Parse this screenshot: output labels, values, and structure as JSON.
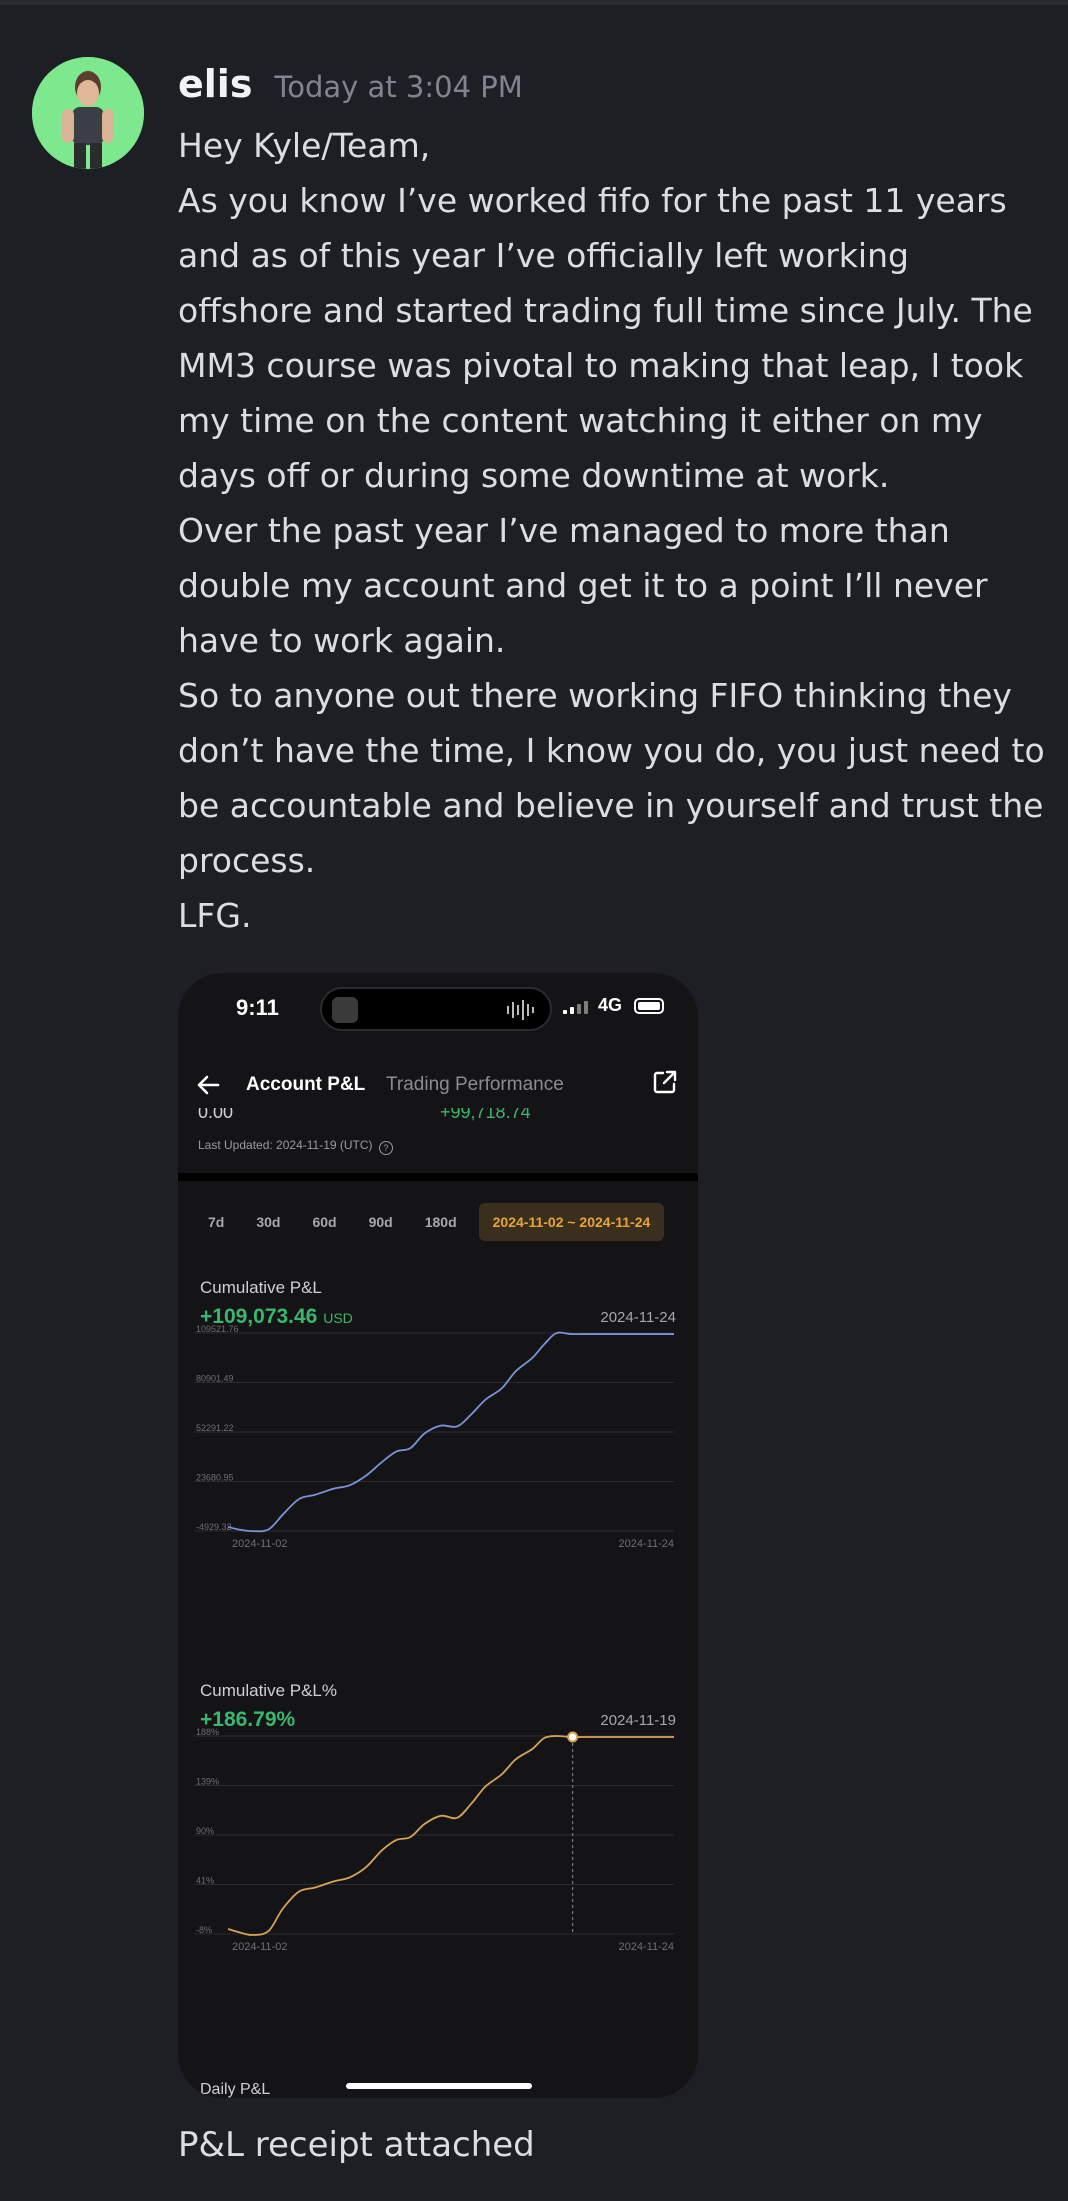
{
  "message": {
    "username": "elis",
    "timestamp": "Today at 3:04 PM",
    "lines": [
      "Hey Kyle/Team,",
      "As you know I’ve worked fifo for the past 11 years and as of this year I’ve officially left working offshore and started trading full time since July. The MM3 course was pivotal to making that leap, I took my time on the content watching it either on my days off or during some downtime at work.",
      "Over the past year I’ve managed to more than double my account and get it to a point I’ll never have to work again.",
      "So to anyone out there working FIFO thinking they don’t have the time, I know you do, you just need to be accountable and believe in yourself and trust the process.",
      "LFG."
    ],
    "footer": "P&L receipt attached"
  },
  "phone": {
    "status_time": "9:11",
    "network": "4G",
    "nav": {
      "active_tab": "Account P&L",
      "inactive_tab": "Trading Performance"
    },
    "cut_left": "0.00",
    "cut_right": "+99,718.74",
    "last_updated": "Last Updated: 2024-11-19 (UTC)",
    "ranges": [
      "7d",
      "30d",
      "60d",
      "90d",
      "180d"
    ],
    "selected_range": "2024-11-02 ~ 2024-11-24",
    "daily_label": "Daily P&L"
  },
  "colors": {
    "pnl_line": "#7b93d6",
    "pct_line": "#d7a356",
    "positive": "#38b76e",
    "range_selected": "#e7a33c"
  },
  "chart_data": [
    {
      "type": "line",
      "title": "Cumulative P&L",
      "headline_value": "+109,073.46",
      "headline_unit": "USD",
      "date_label": "2024-11-24",
      "x_start": "2024-11-02",
      "x_end": "2024-11-24",
      "y_ticks": [
        "109521.76",
        "80901.49",
        "52291.22",
        "23680.95",
        "-4929.32"
      ],
      "ylim": [
        -4929.32,
        109521.76
      ],
      "series": [
        {
          "x": [
            0,
            0.5,
            1.2,
            2,
            2.7,
            3.5,
            4.3,
            5.2,
            6,
            6.8,
            7.6,
            8.3,
            9,
            9.7,
            10.5,
            11.3,
            12,
            12.7,
            13.5,
            14.2,
            15,
            15.6,
            16.2,
            16.9,
            17.5,
            18.2,
            19,
            20,
            21,
            22
          ],
          "y": [
            -2500,
            -4000,
            -5000,
            -4000,
            4500,
            13500,
            16000,
            19500,
            21500,
            27000,
            35000,
            41000,
            43000,
            51500,
            56000,
            55500,
            62500,
            71000,
            77500,
            87500,
            95000,
            103000,
            109500,
            108900,
            108900,
            108900,
            108900,
            108900,
            108900,
            108900
          ]
        }
      ]
    },
    {
      "type": "line",
      "title": "Cumulative P&L%",
      "headline_value": "+186.79%",
      "date_label": "2024-11-19",
      "x_start": "2024-11-02",
      "x_end": "2024-11-24",
      "y_ticks": [
        "188%",
        "139%",
        "90%",
        "41%",
        "-8%"
      ],
      "ylim": [
        -8,
        188
      ],
      "highlight_x": 17,
      "series": [
        {
          "x": [
            0,
            0.5,
            1.2,
            2,
            2.7,
            3.5,
            4.3,
            5.2,
            6,
            6.8,
            7.6,
            8.3,
            9,
            9.7,
            10.5,
            11.3,
            12,
            12.7,
            13.5,
            14.2,
            15,
            15.6,
            16.2,
            16.9,
            17.5,
            18.2,
            19,
            20,
            21,
            22
          ],
          "y": [
            -3,
            -6,
            -9,
            -5,
            17,
            34,
            38,
            44,
            48,
            58,
            75,
            85,
            88,
            101,
            109,
            107,
            121,
            138,
            150,
            165,
            175,
            186,
            188,
            187,
            187,
            187,
            187,
            187,
            187,
            187
          ]
        }
      ]
    }
  ]
}
